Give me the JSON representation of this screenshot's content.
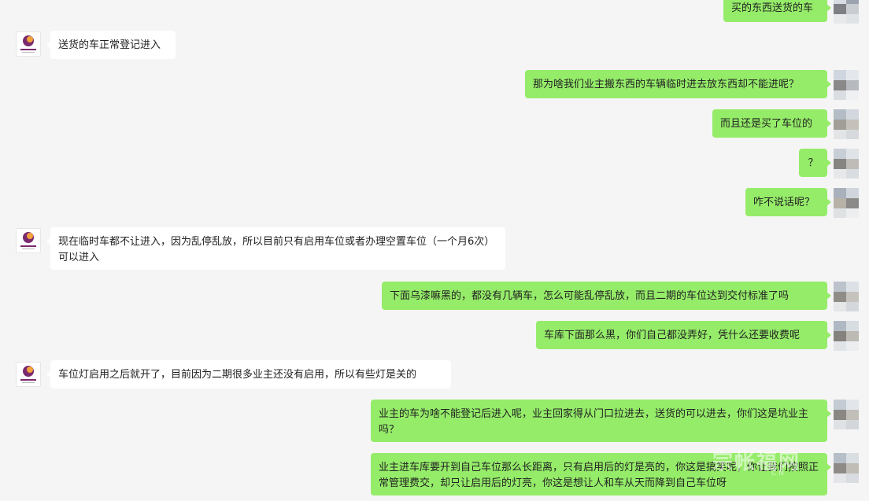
{
  "conversation": {
    "messages": [
      {
        "side": "out",
        "text": "买的东西送货的车"
      },
      {
        "side": "in",
        "text": "送货的车正常登记进入"
      },
      {
        "side": "out",
        "text": "那为啥我们业主搬东西的车辆临时进去放东西却不能进呢？"
      },
      {
        "side": "out",
        "text": "而且还是买了车位的"
      },
      {
        "side": "out",
        "text": "？"
      },
      {
        "side": "out",
        "text": "咋不说话呢？"
      },
      {
        "side": "in",
        "text": "现在临时车都不让进入，因为乱停乱放，所以目前只有启用车位或者办理空置车位（一个月6次）可以进入"
      },
      {
        "side": "out",
        "text": "下面乌漆嘛黑的，都没有几辆车，怎么可能乱停乱放，而且二期的车位达到交付标准了吗"
      },
      {
        "side": "out",
        "text": "车库下面那么黑，你们自己都没弄好，凭什么还要收费呢"
      },
      {
        "side": "in",
        "text": "车位灯启用之后就开了，目前因为二期很多业主还没有启用，所以有些灯是关的"
      },
      {
        "side": "out",
        "text": "业主的车为啥不能登记后进入呢，业主回家得从门口拉进去，送货的可以进去，你们这是坑业主吗？"
      },
      {
        "side": "out",
        "text": "业主进车库要开到自己车位那么长距离，只有启用后的灯是亮的，你这是搞笑呢，你让我们按照正常管理费交，却只让启用后的灯亮，你这是想让人和车从天而降到自己车位呀"
      }
    ]
  },
  "avatars": {
    "in_icon": "property-logo-icon",
    "out_icon": "pixelated-user-avatar-icon"
  },
  "watermark": {
    "text": "宗帐福网",
    "sub": "CN"
  },
  "colors": {
    "background": "#f5f5f5",
    "outgoing_bubble": "#95ec69",
    "incoming_bubble": "#ffffff"
  }
}
